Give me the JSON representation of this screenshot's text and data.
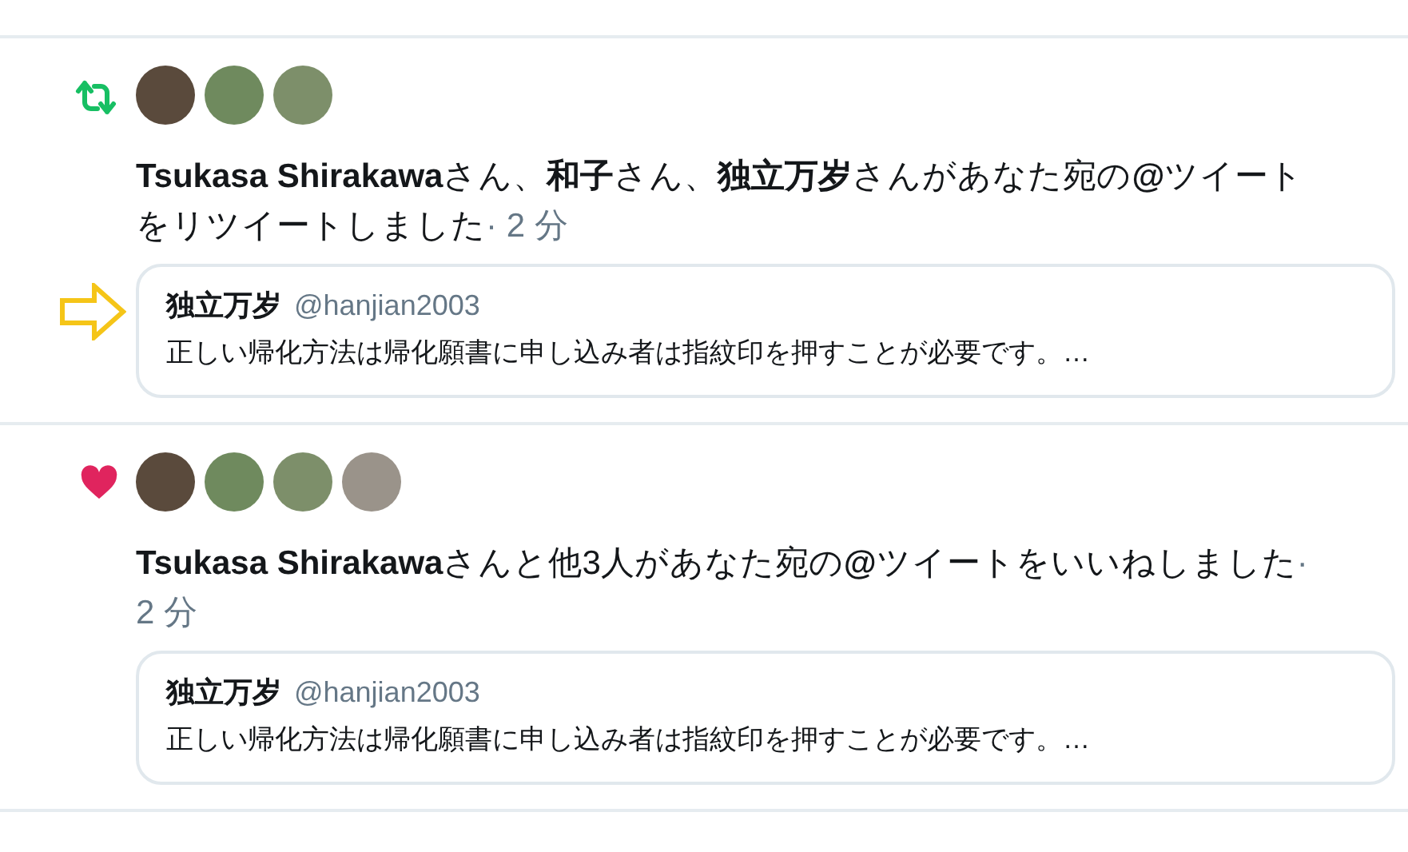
{
  "notifications": [
    {
      "kind": "retweet",
      "avatars": [
        {
          "kind": "photo"
        },
        {
          "kind": "photo"
        },
        {
          "kind": "photo"
        }
      ],
      "message": "**Tsukasa Shirakawa**さん、**和子**さん、**独立万岁**さんがあなた宛の**@**ツイートをリツイートしました",
      "time": "· 2 分",
      "tweet": {
        "name": "独立万岁",
        "handle": "@hanjian2003",
        "text": "正しい帰化方法は帰化願書に申し込み者は指紋印を押すことが必要です。…",
        "pointed": true
      }
    },
    {
      "kind": "like",
      "avatars": [
        {
          "kind": "photo"
        },
        {
          "kind": "photo"
        },
        {
          "kind": "photo"
        },
        {
          "kind": "photo"
        }
      ],
      "message": "**Tsukasa Shirakawa**さんと他3人があなた宛の**@**ツイートをいいねしました",
      "time": "· 2 分",
      "tweet": {
        "name": "独立万岁",
        "handle": "@hanjian2003",
        "text": "正しい帰化方法は帰化願書に申し込み者は指紋印を押すことが必要です。…",
        "pointed": false
      }
    }
  ]
}
